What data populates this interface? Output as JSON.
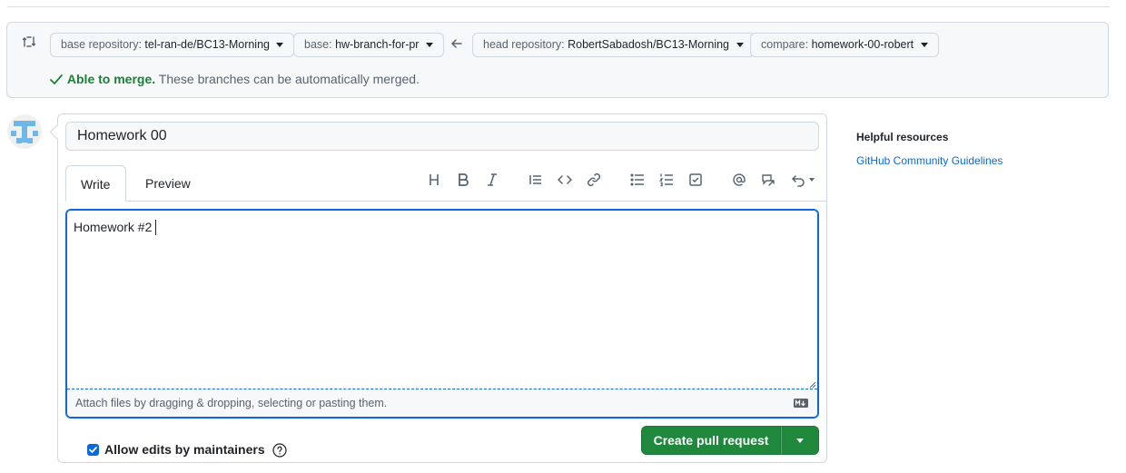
{
  "compare": {
    "base_repository": {
      "key": "base repository:",
      "value": "tel-ran-de/BC13-Morning"
    },
    "base": {
      "key": "base:",
      "value": "hw-branch-for-pr"
    },
    "head_repository": {
      "key": "head repository:",
      "value": "RobertSabadosh/BC13-Morning"
    },
    "compare": {
      "key": "compare:",
      "value": "homework-00-robert"
    },
    "merge_status": "Able to merge.",
    "merge_description": "These branches can be automatically merged."
  },
  "form": {
    "title_value": "Homework 00",
    "tabs": [
      "Write",
      "Preview"
    ],
    "body_text": "Homework #2",
    "attach_hint": "Attach files by dragging & dropping, selecting or pasting them.",
    "allow_edits_label": "Allow edits by maintainers",
    "allow_edits_checked": true,
    "submit_label": "Create pull request"
  },
  "toolbar": {
    "icons": [
      "heading-icon",
      "bold-icon",
      "italic-icon",
      "quote-icon",
      "code-icon",
      "link-icon",
      "unordered-list-icon",
      "ordered-list-icon",
      "task-list-icon",
      "mention-icon",
      "reference-icon",
      "undo-icon"
    ]
  },
  "sidebar": {
    "heading": "Helpful resources",
    "link": "GitHub Community Guidelines"
  },
  "colors": {
    "accent": "#0969da",
    "success": "#1a7f37",
    "button": "#1f883d"
  }
}
